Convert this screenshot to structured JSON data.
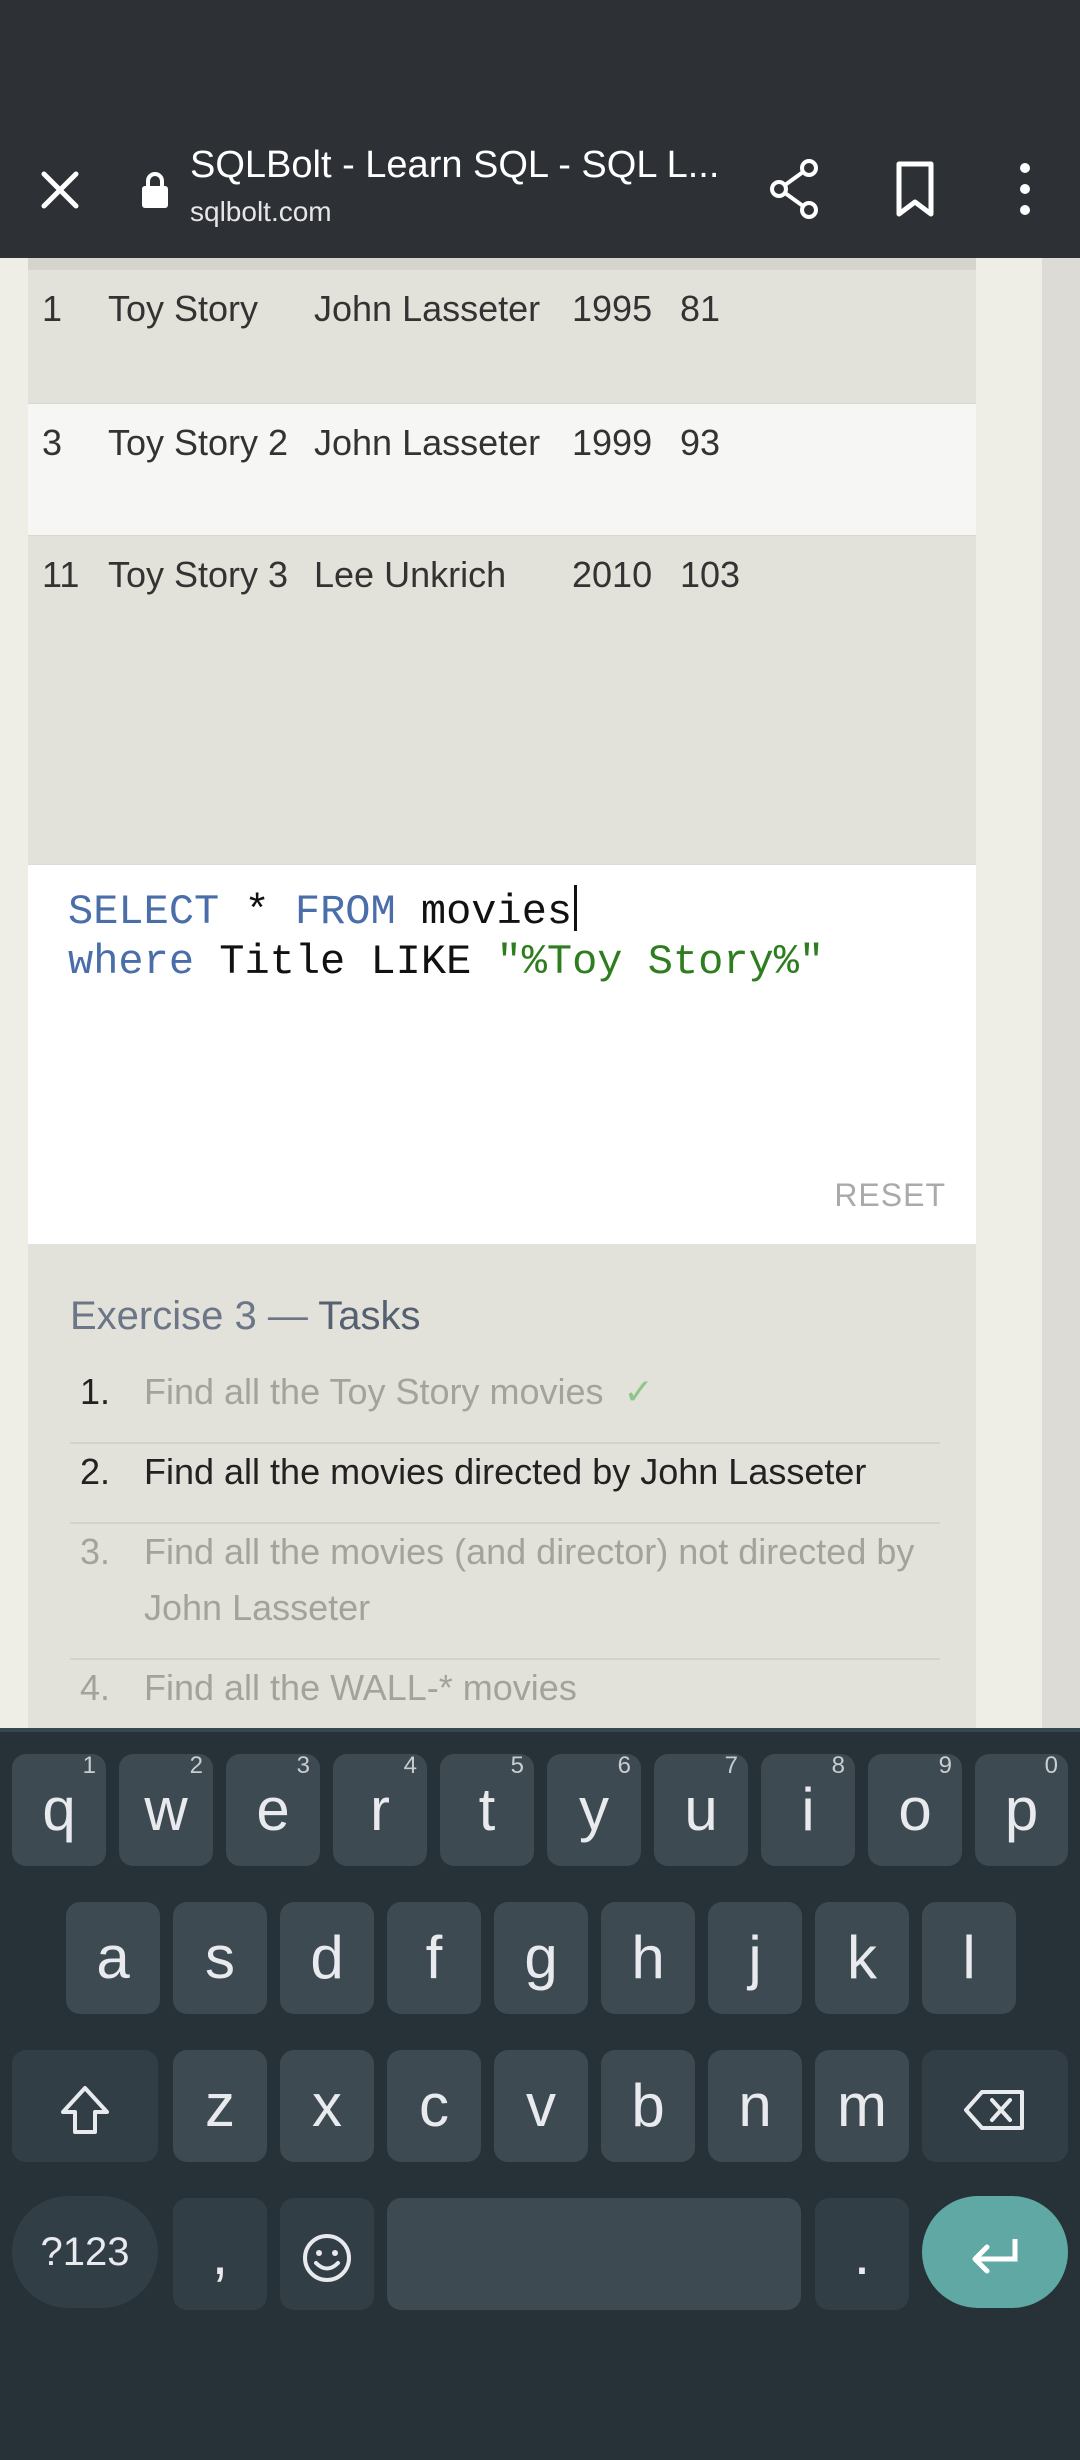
{
  "browser": {
    "title": "SQLBolt - Learn SQL - SQL L...",
    "url": "sqlbolt.com"
  },
  "results": [
    {
      "id": "1",
      "title": "Toy Story",
      "director": "John Lasseter",
      "year": "1995",
      "length": "81"
    },
    {
      "id": "3",
      "title": "Toy Story 2",
      "director": "John Lasseter",
      "year": "1999",
      "length": "93"
    },
    {
      "id": "11",
      "title": "Toy Story 3",
      "director": "Lee Unkrich",
      "year": "2010",
      "length": "103"
    }
  ],
  "editor": {
    "line1_kw1": "SELECT",
    "line1_mid": " * ",
    "line1_kw2": "FROM",
    "line1_tail": " movies",
    "line2_kw": "where",
    "line2_mid": " Title LIKE ",
    "line2_str": "\"%Toy Story%\"",
    "reset_label": "RESET"
  },
  "tasks": {
    "title_main": "Exercise 3",
    "title_sep": " — ",
    "title_strong": "Tasks",
    "items": [
      {
        "num": "1.",
        "text": "Find all the Toy Story movies",
        "check": "✓"
      },
      {
        "num": "2.",
        "text": "Find all the movies directed by John Lasseter"
      },
      {
        "num": "3.",
        "text": "Find all the movies (and director) not directed by John Lasseter"
      },
      {
        "num": "4.",
        "text": "Find all the WALL-* movies"
      }
    ]
  },
  "keyboard": {
    "row1": [
      {
        "k": "q",
        "h": "1"
      },
      {
        "k": "w",
        "h": "2"
      },
      {
        "k": "e",
        "h": "3"
      },
      {
        "k": "r",
        "h": "4"
      },
      {
        "k": "t",
        "h": "5"
      },
      {
        "k": "y",
        "h": "6"
      },
      {
        "k": "u",
        "h": "7"
      },
      {
        "k": "i",
        "h": "8"
      },
      {
        "k": "o",
        "h": "9"
      },
      {
        "k": "p",
        "h": "0"
      }
    ],
    "row2": [
      "a",
      "s",
      "d",
      "f",
      "g",
      "h",
      "j",
      "k",
      "l"
    ],
    "row3": [
      "z",
      "x",
      "c",
      "v",
      "b",
      "n",
      "m"
    ],
    "sym_label": "?123",
    "comma": ",",
    "period": "."
  }
}
